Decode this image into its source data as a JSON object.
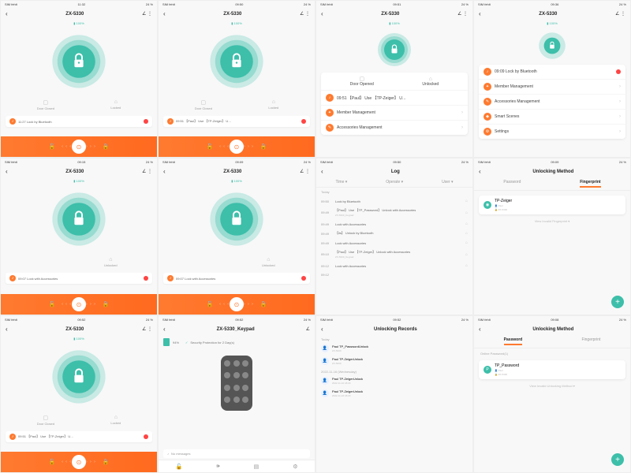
{
  "status": {
    "carrier": "SIM fehlt",
    "wifi": "◉",
    "batt": "24 %"
  },
  "device": {
    "title": "ZX-5330",
    "battery": "100%"
  },
  "doorStatus": {
    "closedLabel": "Door Closed",
    "openedLabel": "Door Opened",
    "lockedLabel": "Locked",
    "unlockedLabel": "Unlocked"
  },
  "times": {
    "t1": "11:32",
    "t2": "09:50",
    "t3": "09:51",
    "t4": "09:36",
    "t5": "09:15",
    "t6": "09:09",
    "t7": "09:52",
    "t8": "09:08",
    "t9": "09:09"
  },
  "alerts": {
    "a1": "11:27  Lock by Bluetooth",
    "a2": "09:51  【Paul】 Use 【TP-Zeiger】 U…",
    "a3": "09:51  【Paul】 Use 【TP-Zeiger】 U…",
    "a4": "09:09  Lock by Bluetooth",
    "a5": "09:07  Lock with Accessories",
    "a6": "09:07  Lock with Accessories",
    "a7": "09:51  【Paul】 Use 【TP-Zeiger】 U…"
  },
  "menu": {
    "member": "Member Management",
    "acc": "Accessories Management",
    "scenes": "Smart Scenes",
    "settings": "Settings"
  },
  "log": {
    "title": "Log",
    "tabs": {
      "time": "Time ▾",
      "op": "Operate ▾",
      "user": "User ▾"
    },
    "dateToday": "Today",
    "items": [
      {
        "t": "09:50",
        "d": "Lock by Bluetooth"
      },
      {
        "t": "09:49",
        "d": "【Paul】 Use 【TP_Password】 Unlock with Accessories",
        "s": "ZX-5330_Keypad"
      },
      {
        "t": "09:49",
        "d": "Lock with Accessories"
      },
      {
        "t": "09:49",
        "d": "【lis】  Unlock by Bluetooth"
      },
      {
        "t": "09:49",
        "d": "Lock with Accessories"
      },
      {
        "t": "09:10",
        "d": "【Paul】 Use 【TP-Zeiger】 Unlock with Accessories",
        "s": "ZX-5330_Keypad"
      },
      {
        "t": "09:12",
        "d": "Lock with Accessories"
      },
      {
        "t": "09:12",
        "d": ""
      }
    ]
  },
  "unlock": {
    "title": "Unlocking Method",
    "tabPwd": "Password",
    "tabFp": "Fingerprint",
    "fp": {
      "name": "TP-Zeiger",
      "owner": "Paul",
      "dev": "ZX-5330"
    },
    "pwd": {
      "section": "Online Password(1)",
      "name": "TP_Password",
      "owner": "Paul",
      "dev": "ZX-5330"
    },
    "viewInvalidFp": "View Invalid Fingerprint ▾",
    "viewInvalidUm": "View Invalid Unlocking Method ▾"
  },
  "keypad": {
    "title": "ZX-5330_Keypad",
    "batt": "94%",
    "sec": "Security Protection for 2 Day(s)",
    "nomsg": "No messages"
  },
  "records": {
    "title": "Unlocking Records",
    "today": "Today",
    "wed": "2022-11-16 (Wednesday)",
    "items": [
      {
        "n": "Paul TP_PasswordUnlock",
        "s": "ZX-5330"
      },
      {
        "n": "Paul TP-ZeigerUnlock",
        "s": "ZX-5330"
      },
      {
        "n": "Paul TP-ZeigerUnlock",
        "s": "2022-11-16 18:20"
      },
      {
        "n": "Paul TP-ZeigerUnlock",
        "s": "2022-11-16 18:20"
      }
    ]
  }
}
